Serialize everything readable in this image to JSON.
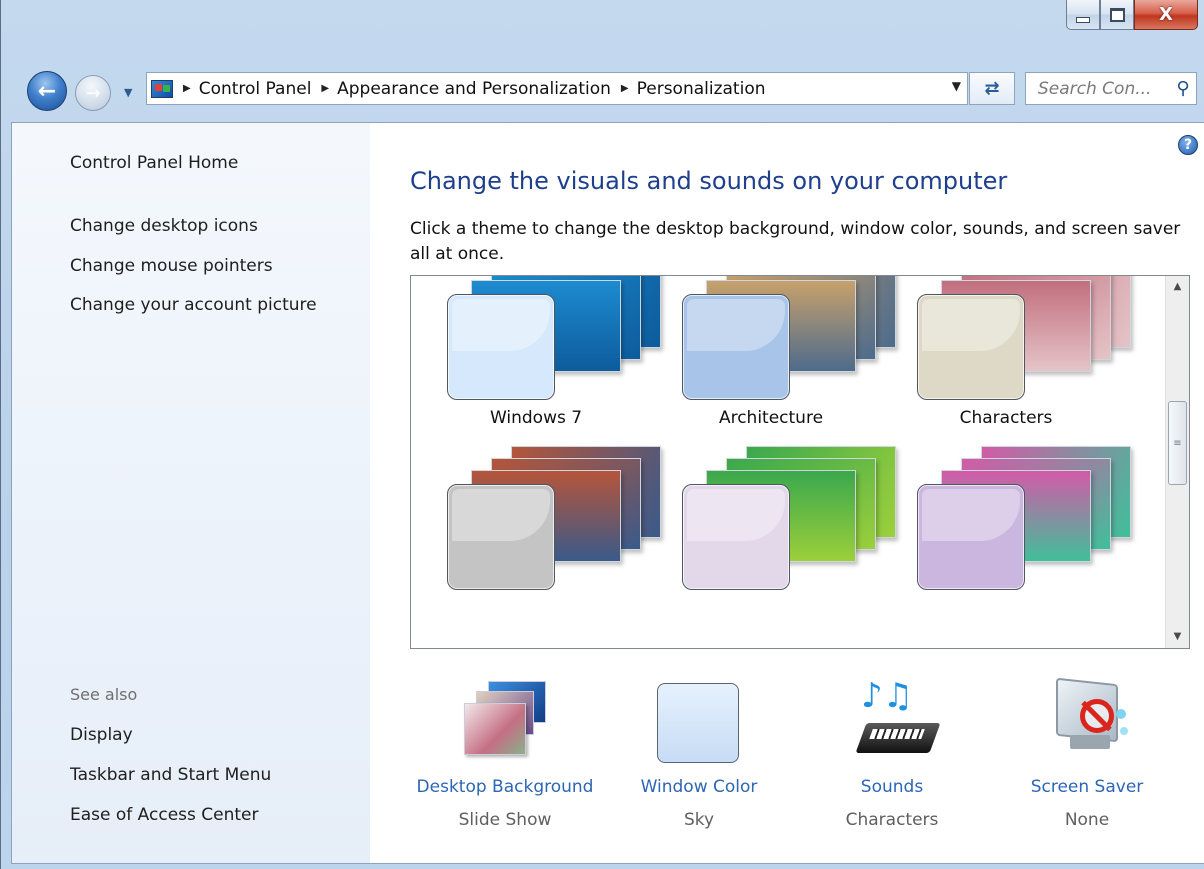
{
  "window": {
    "caption": {
      "minimize_glyph": "minimize",
      "maximize_glyph": "maximize",
      "close_label": "X"
    }
  },
  "navbar": {
    "breadcrumbs": [
      "Control Panel",
      "Appearance and Personalization",
      "Personalization"
    ],
    "search_placeholder": "Search Con..."
  },
  "left_pane": {
    "home_link": "Control Panel Home",
    "tasks": [
      "Change desktop icons",
      "Change mouse pointers",
      "Change your account picture"
    ],
    "see_also_heading": "See also",
    "see_also": [
      "Display",
      "Taskbar and Start Menu",
      "Ease of Access Center"
    ]
  },
  "main": {
    "title": "Change the visuals and sounds on your computer",
    "description": "Click a theme to change the desktop background, window color, sounds, and screen saver all at once.",
    "themes": [
      {
        "label": "Windows 7",
        "swatch_color": "#d6e8fb",
        "image_colors": [
          "#1d8bd0",
          "#0d5c9c"
        ]
      },
      {
        "label": "Architecture",
        "swatch_color": "#a8c4e8",
        "image_colors": [
          "#c8a16b",
          "#4d6b8c"
        ]
      },
      {
        "label": "Characters",
        "swatch_color": "#ded9c6",
        "image_colors": [
          "#c26f7e",
          "#e4c4c8"
        ]
      },
      {
        "label": "",
        "swatch_color": "#c4c4c4",
        "image_colors": [
          "#b5553a",
          "#3a5a8a"
        ]
      },
      {
        "label": "",
        "swatch_color": "#e3d8ea",
        "image_colors": [
          "#3aa84d",
          "#9ccf3b"
        ]
      },
      {
        "label": "",
        "swatch_color": "#cbb6df",
        "image_colors": [
          "#d35aa7",
          "#3fbf9a"
        ]
      }
    ]
  },
  "settings": [
    {
      "name": "Desktop Background",
      "value": "Slide Show",
      "icon": "desktop-background-icon"
    },
    {
      "name": "Window Color",
      "value": "Sky",
      "icon": "window-color-icon"
    },
    {
      "name": "Sounds",
      "value": "Characters",
      "icon": "sounds-icon"
    },
    {
      "name": "Screen Saver",
      "value": "None",
      "icon": "screen-saver-icon"
    }
  ],
  "colors": {
    "title_blue": "#1e3f8e",
    "link_blue": "#2d66b4",
    "frame": "#bcd4ec"
  }
}
